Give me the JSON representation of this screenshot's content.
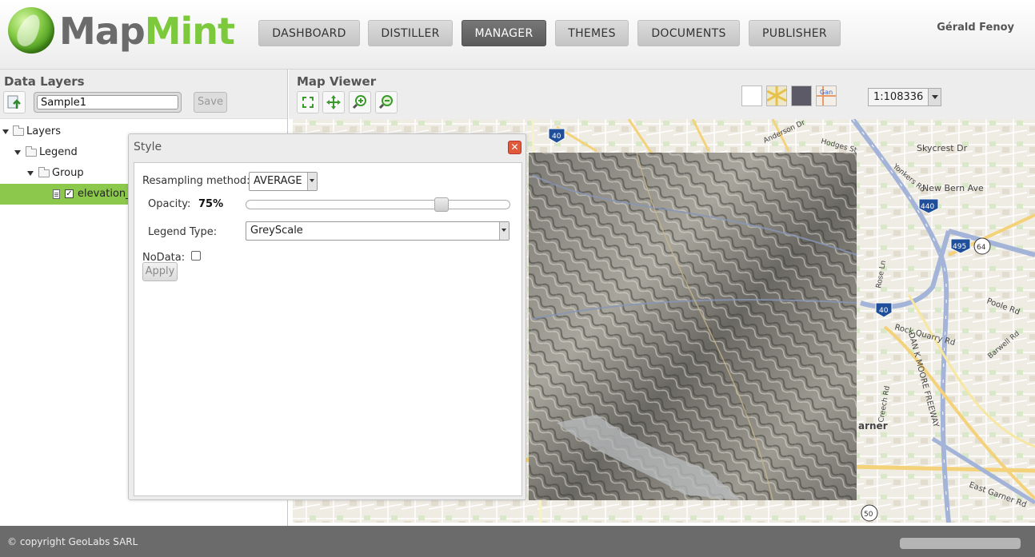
{
  "header": {
    "logo_map": "Map",
    "logo_mint": "Mint",
    "user": "Gérald Fenoy"
  },
  "nav": [
    {
      "label": "DASHBOARD",
      "active": false
    },
    {
      "label": "DISTILLER",
      "active": false
    },
    {
      "label": "MANAGER",
      "active": true
    },
    {
      "label": "THEMES",
      "active": false
    },
    {
      "label": "DOCUMENTS",
      "active": false
    },
    {
      "label": "PUBLISHER",
      "active": false
    }
  ],
  "data_layers": {
    "title": "Data Layers",
    "name_value": "Sample1",
    "save_label": "Save",
    "tree": [
      {
        "label": "Layers",
        "level": 0,
        "type": "folder"
      },
      {
        "label": "Legend",
        "level": 1,
        "type": "folder"
      },
      {
        "label": "Group",
        "level": 2,
        "type": "folder"
      },
      {
        "label": "elevation_",
        "level": 3,
        "type": "layer",
        "checked": true,
        "selected": true
      }
    ]
  },
  "map_viewer": {
    "title": "Map Viewer",
    "tools": [
      "zoom-extent-icon",
      "pan-icon",
      "zoom-in-icon",
      "zoom-out-icon"
    ],
    "base_layers": [
      "blank-icon",
      "roads-icon",
      "satellite-icon",
      "google-icon"
    ],
    "scale": "1:108336",
    "labels": {
      "skycrest": "Skycrest Dr",
      "newbern": "New Bern Ave",
      "poole": "Poole Rd",
      "rockquarry": "Rock Quarry Rd",
      "barwell": "Barwell Rd",
      "dank": "DAN K MOORE FREEWAY",
      "garner": "arner",
      "eastgarner": "East Garner Rd",
      "roseln": "Rose Ln",
      "creech": "Creech Rd",
      "anderson": "Anderson Dr",
      "hodges": "Hodges St",
      "yonkers": "Yonkers Rd"
    },
    "shields": {
      "i40a": "40",
      "i440": "440",
      "i495": "495",
      "us64": "64",
      "i40b": "40",
      "us50": "50"
    }
  },
  "style_dialog": {
    "title": "Style",
    "resampling_label": "Resampling method:",
    "resampling_value": "AVERAGE",
    "opacity_label": "Opacity:",
    "opacity_value": "75%",
    "opacity_fraction": 0.75,
    "legend_type_label": "Legend Type:",
    "legend_type_value": "GreyScale",
    "nodata_label": "NoData:",
    "apply_label": "Apply"
  },
  "footer": {
    "copyright": "© copyright GeoLabs SARL"
  },
  "colors": {
    "accent_green": "#8cc84b",
    "active_nav": "#5a5a5a",
    "footer": "#6b6b6b",
    "close_red": "#e05a3a"
  }
}
